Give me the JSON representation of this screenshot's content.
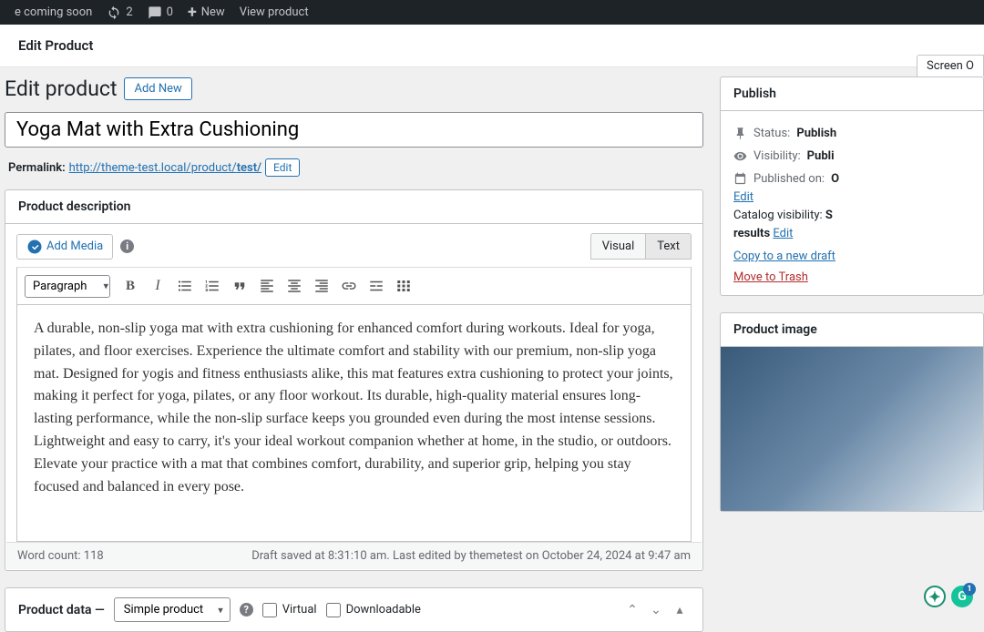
{
  "adminBar": {
    "comingSoon": "e coming soon",
    "updates": "2",
    "comments": "0",
    "newLabel": "New",
    "viewProduct": "View product"
  },
  "headerBar": {
    "title": "Edit Product"
  },
  "page": {
    "heading": "Edit product",
    "addNew": "Add New",
    "screenOptions": "Screen O"
  },
  "product": {
    "title": "Yoga Mat with Extra Cushioning",
    "permalinkLabel": "Permalink:",
    "permalinkBase": "http://theme-test.local/product/",
    "permalinkSlug": "test/",
    "editLabel": "Edit"
  },
  "descriptionPanel": {
    "title": "Product description",
    "addMedia": "Add Media",
    "tabs": {
      "visual": "Visual",
      "text": "Text"
    },
    "paragraphSelect": "Paragraph",
    "bodyText": "A durable, non-slip yoga mat with extra cushioning for enhanced comfort during workouts. Ideal for yoga, pilates, and floor exercises. Experience the ultimate comfort and stability with our premium, non-slip yoga mat. Designed for yogis and fitness enthusiasts alike, this mat features extra cushioning to protect your joints, making it perfect for yoga, pilates, or any floor workout. Its durable, high-quality material ensures long-lasting performance, while the non-slip surface keeps you grounded even during the most intense sessions. Lightweight and easy to carry, it's your ideal workout companion whether at home, in the studio, or outdoors. Elevate your practice with a mat that combines comfort, durability, and superior grip, helping you stay focused and balanced in every pose.",
    "wordCount": "Word count: 118",
    "draftSaved": "Draft saved at 8:31:10 am. Last edited by themetest on October 24, 2024 at 9:47 am",
    "grammarlyCount": "1"
  },
  "productData": {
    "title": "Product data —",
    "typeSelect": "Simple product",
    "virtualLabel": "Virtual",
    "downloadableLabel": "Downloadable"
  },
  "publish": {
    "title": "Publish",
    "statusLabel": "Status:",
    "statusValue": "Publish",
    "visibilityLabel": "Visibility:",
    "visibilityValue": "Publi",
    "publishedLabel": "Published on:",
    "publishedValue": "O",
    "editLabel": "Edit",
    "catalogLabel": "Catalog visibility:",
    "catalogValue": "S",
    "catalogLine2": "results",
    "copyDraft": "Copy to a new draft",
    "trash": "Move to Trash"
  },
  "productImage": {
    "title": "Product image"
  }
}
